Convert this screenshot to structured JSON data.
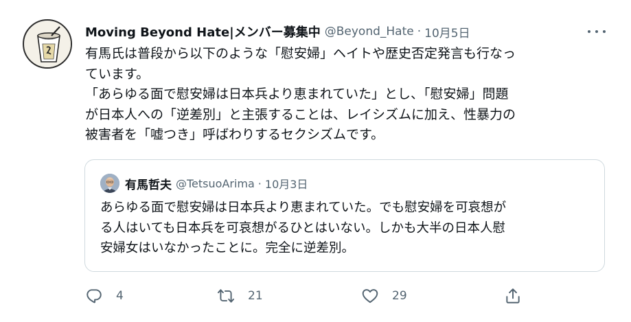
{
  "tweet": {
    "display_name": "Moving Beyond Hate|メンバー募集中",
    "handle": "@Beyond_Hate",
    "separator": "·",
    "date": "10月5日",
    "text_lines": [
      "有馬氏は普段から以下のような「慰安婦」ヘイトや歴史否定発言も行なっ",
      "ています。",
      "「あらゆる面で慰安婦は日本兵より恵まれていた」とし、「慰安婦」問題",
      "が日本人への「逆差別」と主張することは、レイシズムに加え、性暴力の",
      "被害者を「嘘つき」呼ばわりするセクシズムです。"
    ]
  },
  "quoted": {
    "display_name": "有馬哲夫",
    "handle": "@TetsuoArima",
    "separator": "·",
    "date": "10月3日",
    "text_lines": [
      "あらゆる面で慰安婦は日本兵より恵まれていた。でも慰安婦を可哀想が",
      "る人はいても日本兵を可哀想がるひとはいない。しかも大半の日本人慰",
      "安婦女はいなかったことに。完全に逆差別。"
    ]
  },
  "actions": {
    "reply_count": "4",
    "retweet_count": "21",
    "like_count": "29"
  },
  "icons": {
    "more": "more-horizontal-icon",
    "reply": "reply-icon",
    "retweet": "retweet-icon",
    "like": "heart-icon",
    "share": "share-icon"
  },
  "colors": {
    "text": "#0f1419",
    "secondary": "#536471",
    "border": "#cfd9de"
  }
}
